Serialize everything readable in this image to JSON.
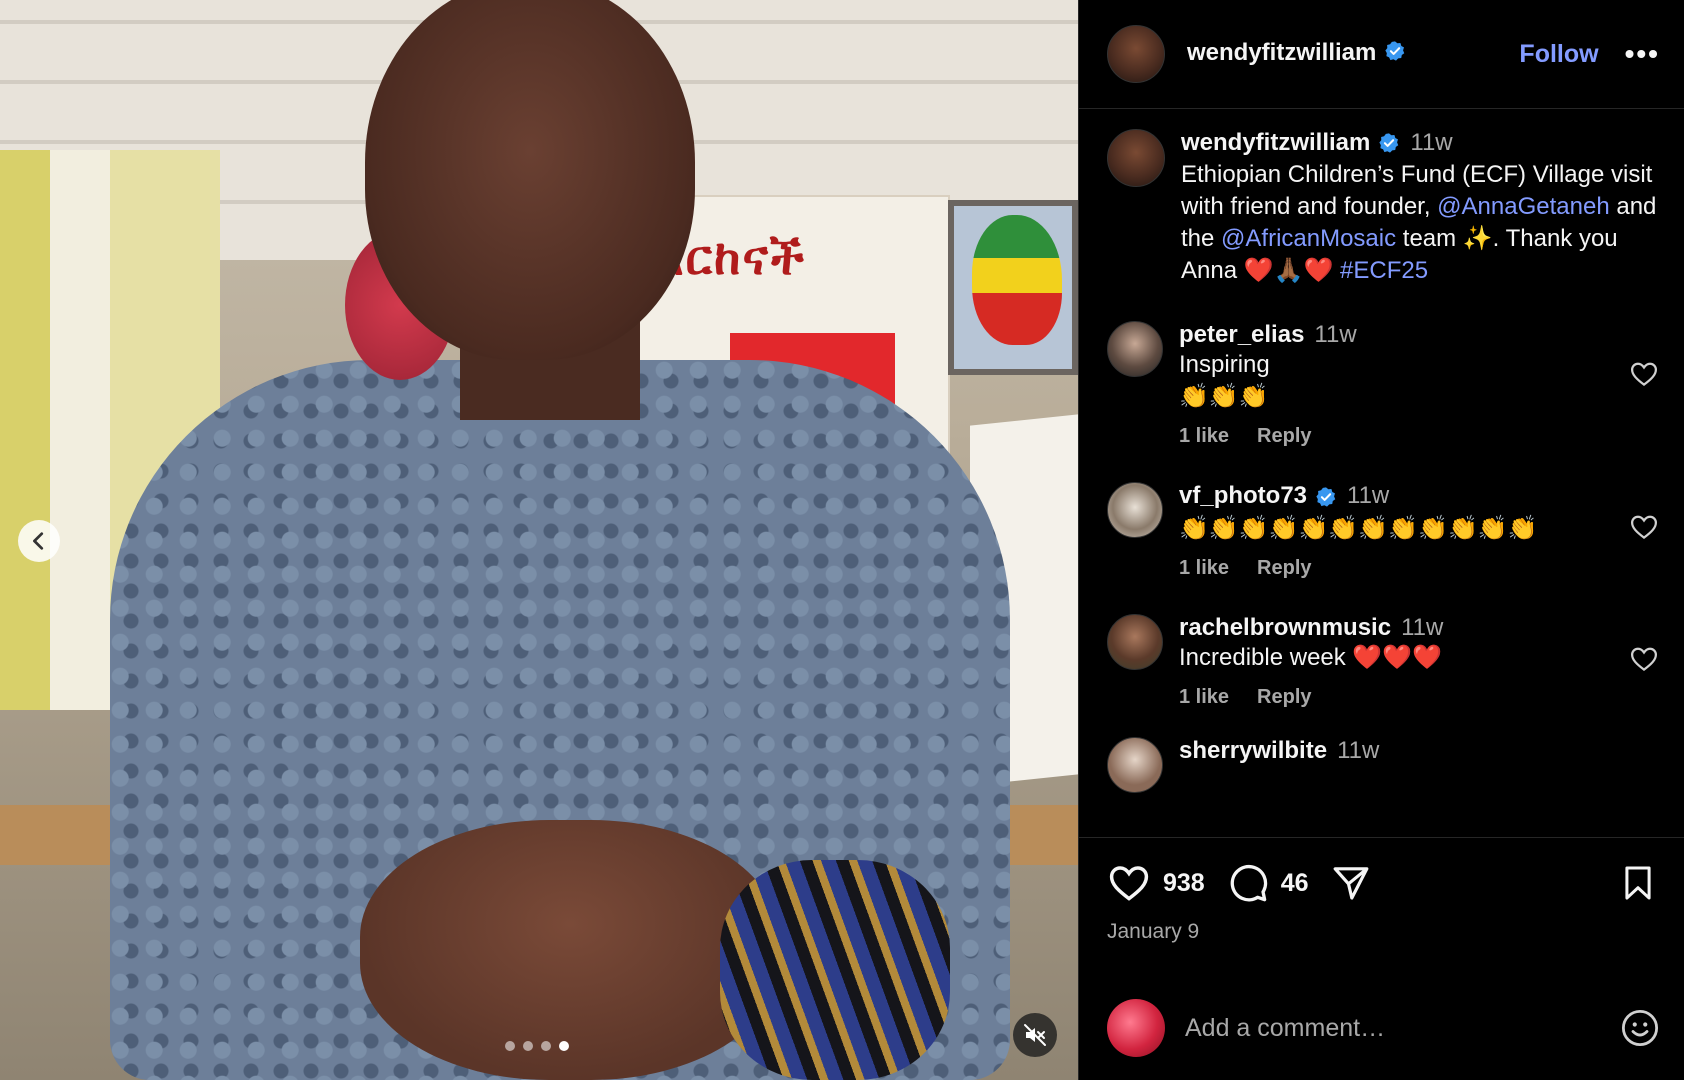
{
  "post": {
    "author": "wendyfitzwilliam",
    "follow_label": "Follow",
    "more_label": "•••"
  },
  "media": {
    "poster_text": "እርከናች",
    "carousel_dots": 4,
    "active_dot": 4
  },
  "caption": {
    "username": "wendyfitzwilliam",
    "time": "11w",
    "text_part1": "Ethiopian Children’s Fund (ECF) Village visit with friend and founder, ",
    "mention1": "@AnnaGetaneh",
    "text_part2": " and the ",
    "mention2": "@AfricanMosaic",
    "text_part3": " team ✨. Thank you Anna ❤️🙏🏾❤️ ",
    "hashtag": "#ECF25"
  },
  "comments": [
    {
      "username": "peter_elias",
      "time": "11w",
      "line1": "Inspiring",
      "line2": "👏👏👏",
      "likes": "1 like",
      "reply": "Reply"
    },
    {
      "username": "vf_photo73",
      "time": "11w",
      "line1": "👏👏👏👏👏👏👏👏👏👏👏👏",
      "likes": "1 like",
      "reply": "Reply"
    },
    {
      "username": "rachelbrownmusic",
      "time": "11w",
      "line1": "Incredible week ❤️❤️❤️",
      "likes": "1 like",
      "reply": "Reply"
    },
    {
      "username": "sherrywilbite",
      "time": "11w"
    }
  ],
  "actions": {
    "likes_count": "938",
    "comments_count": "46",
    "date": "January 9"
  },
  "add_comment": {
    "placeholder": "Add a comment…"
  },
  "colors": {
    "accent": "#839bff",
    "verified": "#3897f0",
    "background": "#000000",
    "muted": "#a8a8a8"
  }
}
